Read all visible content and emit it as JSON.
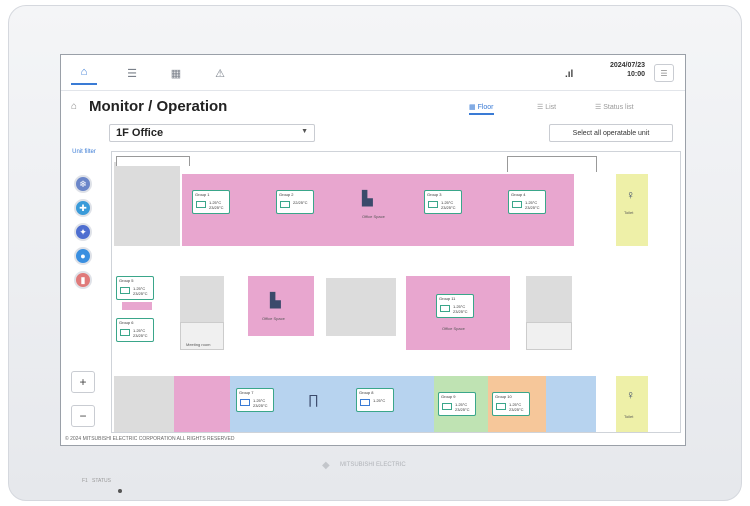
{
  "device": {
    "brand": "MITSUBISHI ELECTRIC",
    "status_label": "STATUS",
    "power_label": "F1"
  },
  "topbar": {
    "tabs": [
      {
        "icon": "monitor-icon",
        "glyph": "⌂",
        "active": true
      },
      {
        "icon": "schedule-icon",
        "glyph": "☰",
        "active": false
      },
      {
        "icon": "energy-icon",
        "glyph": "▦",
        "active": false
      },
      {
        "icon": "alarm-icon",
        "glyph": "⚠",
        "active": false
      }
    ],
    "signal": ".ıl",
    "date": "2024/07/23",
    "time": "10:00",
    "menu_glyph": "☰"
  },
  "header": {
    "title": "Monitor / Operation",
    "views": [
      {
        "label": "Floor",
        "active": true
      },
      {
        "label": "List",
        "active": false
      },
      {
        "label": "Status list",
        "active": false
      }
    ]
  },
  "controls": {
    "floor": "1F  Office",
    "select_all": "Select all operatable unit"
  },
  "side": {
    "unit_filter": "Unit filter",
    "filters": [
      {
        "icon": "air-conditioner-icon",
        "color": "#6b86c9"
      },
      {
        "icon": "ventilation-icon",
        "color": "#3a9bd9"
      },
      {
        "icon": "hot-water-icon",
        "color": "#4e6ed0"
      },
      {
        "icon": "water-heater-icon",
        "color": "#3a8fe0"
      },
      {
        "icon": "general-equipment-icon",
        "color": "#e07a7a"
      }
    ],
    "zoom_in": "+",
    "zoom_out": "−"
  },
  "floorplan": {
    "groups": [
      {
        "name": "Group 1",
        "value": "1.25°C\n23/25°C"
      },
      {
        "name": "Group 2",
        "value": "22/25°C"
      },
      {
        "name": "Group 3",
        "value": "1.25°C\n23/25°C"
      },
      {
        "name": "Group 4",
        "value": "1.25°C\n23/25°C"
      },
      {
        "name": "Group 5",
        "value": "1.25°C\n23/25°C"
      },
      {
        "name": "Group 6",
        "value": "1.25°C\n23/25°C"
      },
      {
        "name": "Group 11",
        "value": "1.25°C\n23/25°C"
      },
      {
        "name": "Group 7",
        "value": "1.25°C\n23/25°C"
      },
      {
        "name": "Group 8",
        "value": "1.25°C"
      },
      {
        "name": "Group 9",
        "value": "1.25°C\n23/25°C"
      },
      {
        "name": "Group 10",
        "value": "1.25°C\n23/25°C"
      }
    ],
    "labels": {
      "office_space_1": "Office Space",
      "office_space_2": "Office Space",
      "office_space_3": "Office Space",
      "toilet_1": "Toilet",
      "toilet_2": "Toilet",
      "meeting": "Meeting room"
    }
  },
  "footer": {
    "copyright": "© 2024 MITSUBISHI ELECTRIC CORPORATION ALL RIGHTS RESERVED"
  },
  "colors": {
    "accent": "#3a7bd5",
    "pink_room": "#e8a6cf",
    "blue_room": "#b7d3ef",
    "green_room": "#bfe3b3",
    "orange_room": "#f6c79a",
    "yellow_room": "#eef0a8",
    "gray_room": "#dcdcdc",
    "card_border": "#3aa68a"
  }
}
